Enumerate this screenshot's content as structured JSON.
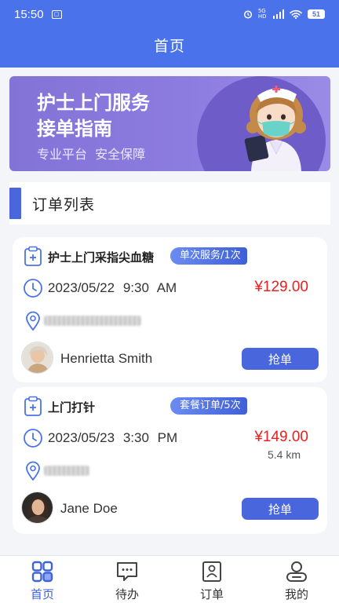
{
  "status_bar": {
    "time": "15:50",
    "network": "5G HD",
    "battery": "51"
  },
  "header": {
    "title": "首页"
  },
  "banner": {
    "title_line1": "护士上门服务",
    "title_line2": "接单指南",
    "subtitle": "专业平台  安全保障"
  },
  "order_list": {
    "title": "订单列表",
    "orders": [
      {
        "service_name": "护士上门采指尖血糖",
        "service_tag": "单次服务/1次",
        "date": "2023/05/22",
        "time": "9:30 AM",
        "price": "¥129.00",
        "distance": "",
        "patient_name": "Henrietta Smith",
        "action_label": "抢单"
      },
      {
        "service_name": "上门打针",
        "service_tag": "套餐订单/5次",
        "date": "2023/05/23",
        "time": "3:30 PM",
        "price": "¥149.00",
        "distance": "5.4 km",
        "patient_name": "Jane Doe",
        "action_label": "抢单"
      }
    ]
  },
  "bottom_nav": {
    "items": [
      {
        "label": "首页",
        "icon": "home-grid-icon",
        "active": true
      },
      {
        "label": "待办",
        "icon": "todo-message-icon",
        "active": false
      },
      {
        "label": "订单",
        "icon": "order-document-icon",
        "active": false
      },
      {
        "label": "我的",
        "icon": "profile-user-icon",
        "active": false
      }
    ]
  },
  "colors": {
    "primary": "#4a72ea",
    "button": "#4a66dc",
    "price": "#e8201f",
    "banner": "#8d7ce0"
  }
}
